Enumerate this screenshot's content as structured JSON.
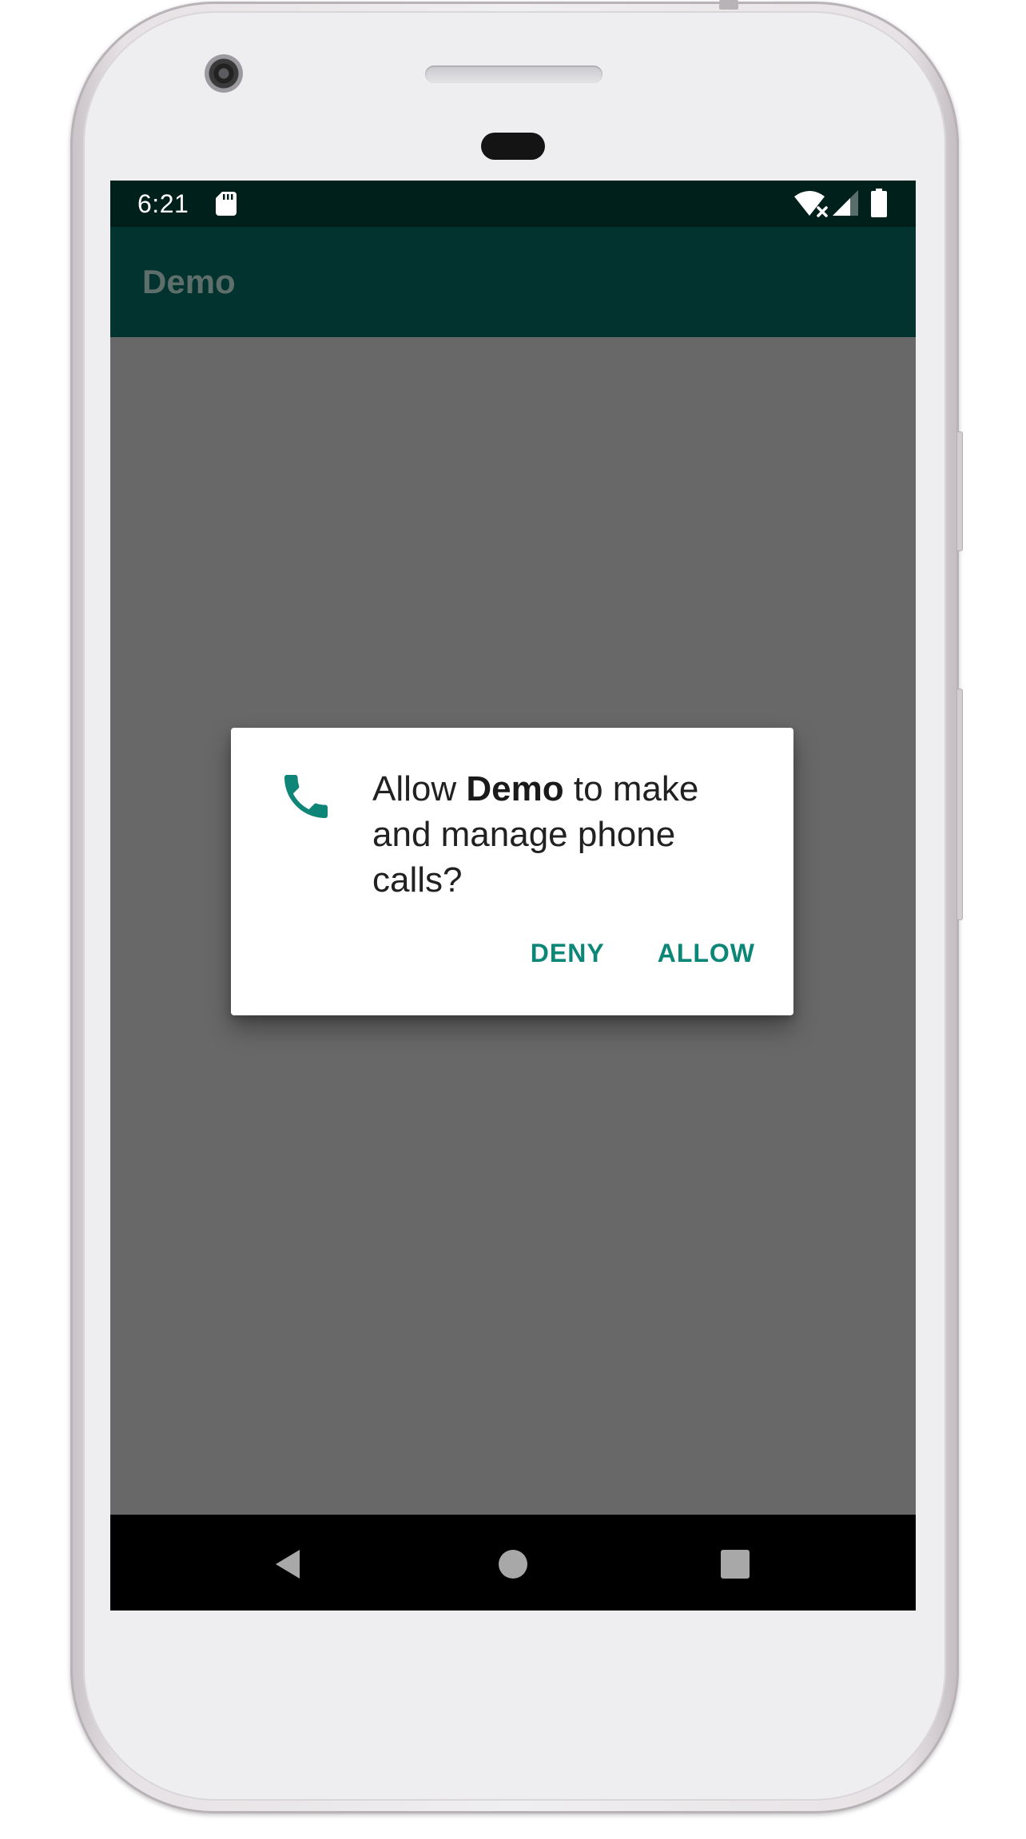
{
  "status_bar": {
    "time": "6:21",
    "icons": [
      "sd-card-icon",
      "wifi-off-icon",
      "cell-signal-icon",
      "battery-icon"
    ]
  },
  "app_bar": {
    "title": "Demo"
  },
  "dialog": {
    "icon": "phone-icon",
    "message_prefix": "Allow ",
    "app_name": "Demo",
    "message_suffix": " to make and manage phone calls?",
    "deny_label": "DENY",
    "allow_label": "ALLOW"
  },
  "nav_bar": {
    "icons": [
      "back-icon",
      "home-icon",
      "recents-icon"
    ]
  },
  "colors": {
    "status_bar": "#00201c",
    "app_bar": "#02332e",
    "scrim": "#686868",
    "accent": "#0b8677"
  }
}
